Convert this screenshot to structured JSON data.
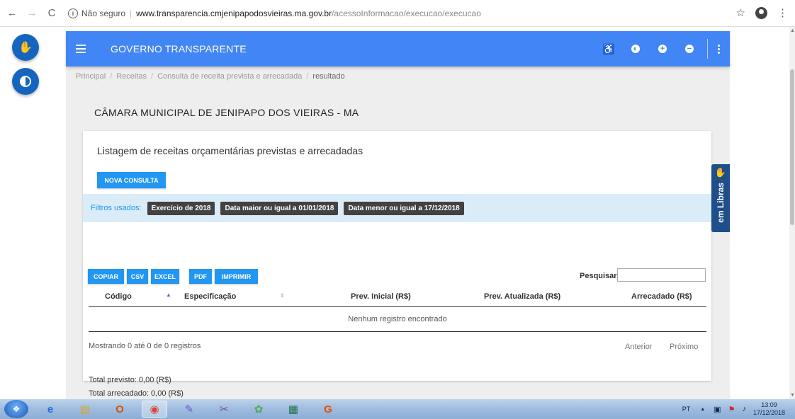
{
  "browser": {
    "security": "Não seguro",
    "url_host": "www.transparencia.cmjenipapodosvieiras.ma.gov.br",
    "url_path": "/acessoInformacao/execucao/execucao"
  },
  "appbar": {
    "title": "GOVERNO TRANSPARENTE"
  },
  "breadcrumb": {
    "items": [
      "Principal",
      "Receitas",
      "Consulta de receita prevista e arrecadada"
    ],
    "current": "resultado"
  },
  "page": {
    "org_title": "CÂMARA MUNICIPAL DE JENIPAPO DOS VIEIRAS - MA",
    "card_title": "Listagem de receitas orçamentárias previstas e arrecadadas",
    "nova_consulta": "NOVA CONSULTA"
  },
  "filters": {
    "label": "Filtros usados:",
    "chips": [
      "Exercício de 2018",
      "Data maior ou igual a 01/01/2018",
      "Data menor ou igual a 17/12/2018"
    ]
  },
  "export": {
    "copiar": "COPIAR",
    "csv": "CSV",
    "excel": "EXCEL",
    "pdf": "PDF",
    "imprimir": "IMPRIMIR"
  },
  "search": {
    "label": "Pesquisar",
    "value": ""
  },
  "table": {
    "columns": [
      "Código",
      "Especificação",
      "Prev. Inicial (R$)",
      "Prev. Atualizada (R$)",
      "Arrecadado (R$)"
    ],
    "empty_message": "Nenhum registro encontrado"
  },
  "pagination": {
    "info": "Mostrando 0 até 0 de 0 registros",
    "previous": "Anterior",
    "next": "Próximo"
  },
  "totals": {
    "previsto": "Total previsto: 0,00 (R$)",
    "arrecadado": "Total arrecadado: 0,00 (R$)"
  },
  "libras_tab": {
    "label": "em Libras"
  },
  "taskbar": {
    "lang": "PT",
    "time": "13:09",
    "date": "17/12/2018"
  },
  "colors": {
    "appbar": "#4285f4",
    "button": "#2196f3",
    "chip": "#424242",
    "filter_bg": "#d9ecf7",
    "fab": "#1565c0"
  }
}
